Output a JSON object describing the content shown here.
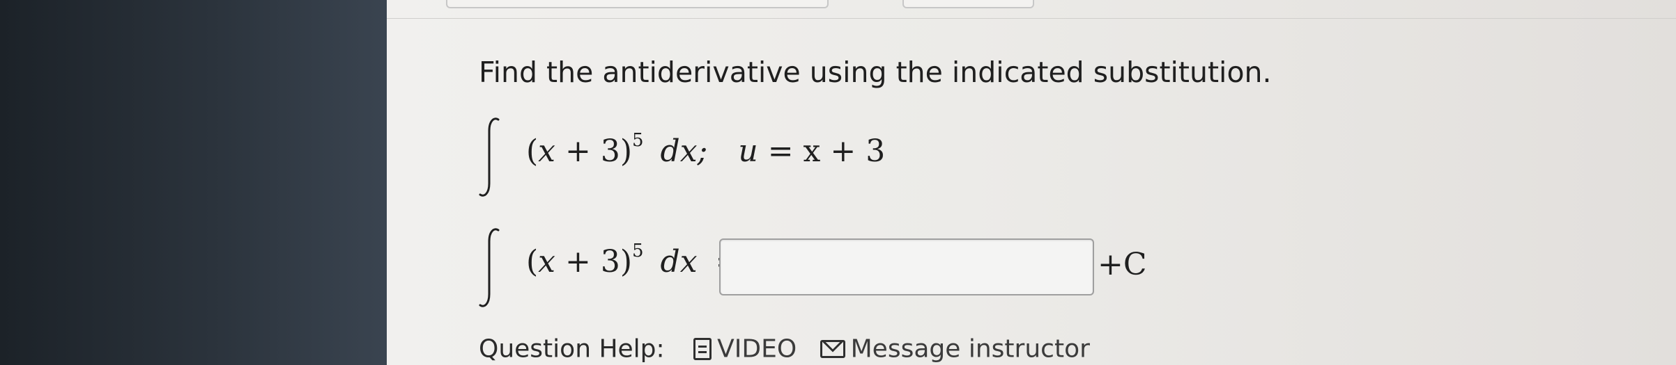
{
  "question": {
    "prompt": "Find the antiderivative using the indicated substitution.",
    "given": {
      "base_open": "(",
      "variable": "x",
      "plus": " + 3)",
      "exponent": "5",
      "differential": "dx;",
      "substitution_var": "u",
      "substitution_rhs": " = x + 3"
    },
    "answer_line": {
      "base_open": "(",
      "variable": "x",
      "plus": " + 3)",
      "exponent": "5",
      "differential": "dx",
      "equals": "=",
      "constant": "+C"
    },
    "answer_input": {
      "value": "",
      "placeholder": ""
    }
  },
  "help": {
    "label": "Question Help:",
    "video_label": "VIDEO",
    "message_label": "Message instructor",
    "video_icon": "document-icon",
    "message_icon": "mail-icon"
  }
}
